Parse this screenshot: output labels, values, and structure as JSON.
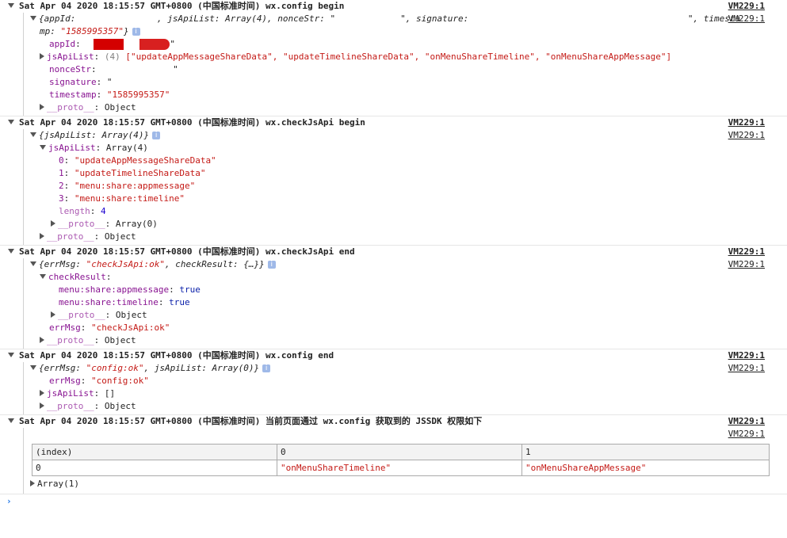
{
  "colors": {
    "key": "#881391",
    "string": "#c41a16",
    "number": "#1c00cf",
    "bool": "#0d22aa",
    "redact": "#d81e1e"
  },
  "groups": [
    {
      "header": "Sat Apr 04 2020 18:15:57 GMT+0800 (中国标准时间) wx.config begin",
      "source": "VM229:1",
      "source2": "VM229:1",
      "preview_appId": "{appId: ",
      "preview_mid1": ", jsApiList: Array(4), nonceStr: \"",
      "preview_mid2": "\", signature: ",
      "preview_tail": "\", timesta",
      "preview_line2a": "mp: ",
      "preview_ts": "\"1585995357\"",
      "preview_close": "}",
      "rows": [
        {
          "key": "appId",
          "sep": ": ",
          "val": "\""
        },
        {
          "key": "jsApiList",
          "sep": ": ",
          "count": "(4) ",
          "val": "[\"updateAppMessageShareData\", \"updateTimelineShareData\", \"onMenuShareTimeline\", \"onMenuShareAppMessage\"]"
        },
        {
          "key": "nonceStr",
          "sep": ": ",
          "val": "\""
        },
        {
          "key": "signature",
          "sep": ": ",
          "val": "\""
        },
        {
          "key": "timestamp",
          "sep": ": ",
          "val": "\"1585995357\""
        },
        {
          "key": "__proto__",
          "sep": ": ",
          "val": "Object"
        }
      ]
    },
    {
      "header": "Sat Apr 04 2020 18:15:57 GMT+0800 (中国标准时间) wx.checkJsApi begin",
      "source": "VM229:1",
      "source2": "VM229:1",
      "preview": "{jsApiList: Array(4)}",
      "jsApiList_label": "jsApiList",
      "jsApiList_val": "Array(4)",
      "items": [
        {
          "idx": "0",
          "val": "\"updateAppMessageShareData\""
        },
        {
          "idx": "1",
          "val": "\"updateTimelineShareData\""
        },
        {
          "idx": "2",
          "val": "\"menu:share:appmessage\""
        },
        {
          "idx": "3",
          "val": "\"menu:share:timeline\""
        }
      ],
      "length_key": "length",
      "length_val": "4",
      "proto_inner": "Array(0)",
      "proto_key": "__proto__",
      "proto_val": "Object"
    },
    {
      "header": "Sat Apr 04 2020 18:15:57 GMT+0800 (中国标准时间) wx.checkJsApi end",
      "source": "VM229:1",
      "source2": "VM229:1",
      "preview_a": "{errMsg: ",
      "preview_s": "\"checkJsApi:ok\"",
      "preview_b": ", checkResult: {…}}",
      "checkResult_label": "checkResult",
      "cr_rows": [
        {
          "key": "menu:share:appmessage",
          "val": "true"
        },
        {
          "key": "menu:share:timeline",
          "val": "true"
        }
      ],
      "proto_val": "Object",
      "errMsg_key": "errMsg",
      "errMsg_val": "\"checkJsApi:ok\""
    },
    {
      "header": "Sat Apr 04 2020 18:15:57 GMT+0800 (中国标准时间) wx.config end",
      "source": "VM229:1",
      "source2": "VM229:1",
      "preview_a": "{errMsg: ",
      "preview_s": "\"config:ok\"",
      "preview_b": ", jsApiList: Array(0)}",
      "errMsg_key": "errMsg",
      "errMsg_val": "\"config:ok\"",
      "jsApiList_key": "jsApiList",
      "jsApiList_val": "[]"
    },
    {
      "header": "Sat Apr 04 2020 18:15:57 GMT+0800 (中国标准时间) 当前页面通过 wx.config 获取到的 JSSDK 权限如下",
      "source": "VM229:1",
      "source2": "VM229:1",
      "table": {
        "headers": [
          "(index)",
          "0",
          "1"
        ],
        "rows": [
          [
            "0",
            "\"onMenuShareTimeline\"",
            "\"onMenuShareAppMessage\""
          ]
        ]
      },
      "array_label": "Array(1)"
    }
  ],
  "prompt": "›"
}
